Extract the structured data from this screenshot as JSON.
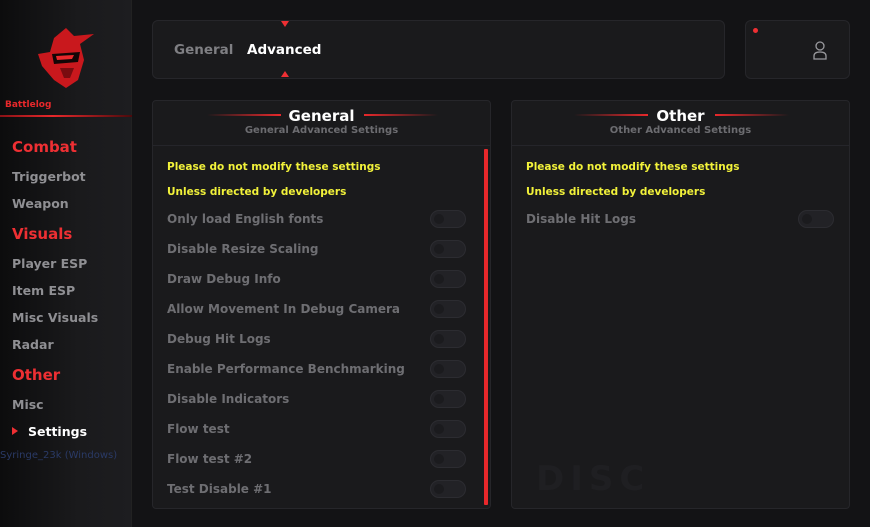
{
  "colors": {
    "accent": "#ee2f33",
    "warning": "#f2f23a",
    "panel": "#1a1a1c",
    "background": "#131315"
  },
  "sidebar": {
    "brand": "Battlelog",
    "logo_icon": "knight-helmet-icon",
    "categories": [
      {
        "label": "Combat",
        "items": [
          {
            "label": "Triggerbot"
          },
          {
            "label": "Weapon"
          }
        ]
      },
      {
        "label": "Visuals",
        "items": [
          {
            "label": "Player ESP"
          },
          {
            "label": "Item ESP"
          },
          {
            "label": "Misc Visuals"
          },
          {
            "label": "Radar"
          }
        ]
      },
      {
        "label": "Other",
        "items": [
          {
            "label": "Misc"
          },
          {
            "label": "Settings",
            "active": true
          }
        ]
      }
    ],
    "footer": "Syringe_23k (Windows)"
  },
  "topbar": {
    "tabs": [
      {
        "label": "General",
        "active": false
      },
      {
        "label": "Advanced",
        "active": true
      }
    ]
  },
  "userbox": {
    "icon": "user-icon",
    "status_icon": "red-dot"
  },
  "panels": {
    "general": {
      "title": "General",
      "subtitle": "General Advanced Settings",
      "warning1": "Please do not modify these settings",
      "warning2": "Unless directed by developers",
      "options": [
        {
          "label": "Only load English fonts",
          "enabled": false
        },
        {
          "label": "Disable Resize Scaling",
          "enabled": false
        },
        {
          "label": "Draw Debug Info",
          "enabled": false
        },
        {
          "label": "Allow Movement In Debug Camera",
          "enabled": false
        },
        {
          "label": "Debug Hit Logs",
          "enabled": false
        },
        {
          "label": "Enable Performance Benchmarking",
          "enabled": false
        },
        {
          "label": "Disable Indicators",
          "enabled": false
        },
        {
          "label": "Flow test",
          "enabled": false
        },
        {
          "label": "Flow test #2",
          "enabled": false
        },
        {
          "label": "Test Disable #1",
          "enabled": false
        }
      ]
    },
    "other": {
      "title": "Other",
      "subtitle": "Other Advanced Settings",
      "warning1": "Please do not modify these settings",
      "warning2": "Unless directed by developers",
      "options": [
        {
          "label": "Disable Hit Logs",
          "enabled": false
        }
      ],
      "watermark": "DISC"
    }
  }
}
